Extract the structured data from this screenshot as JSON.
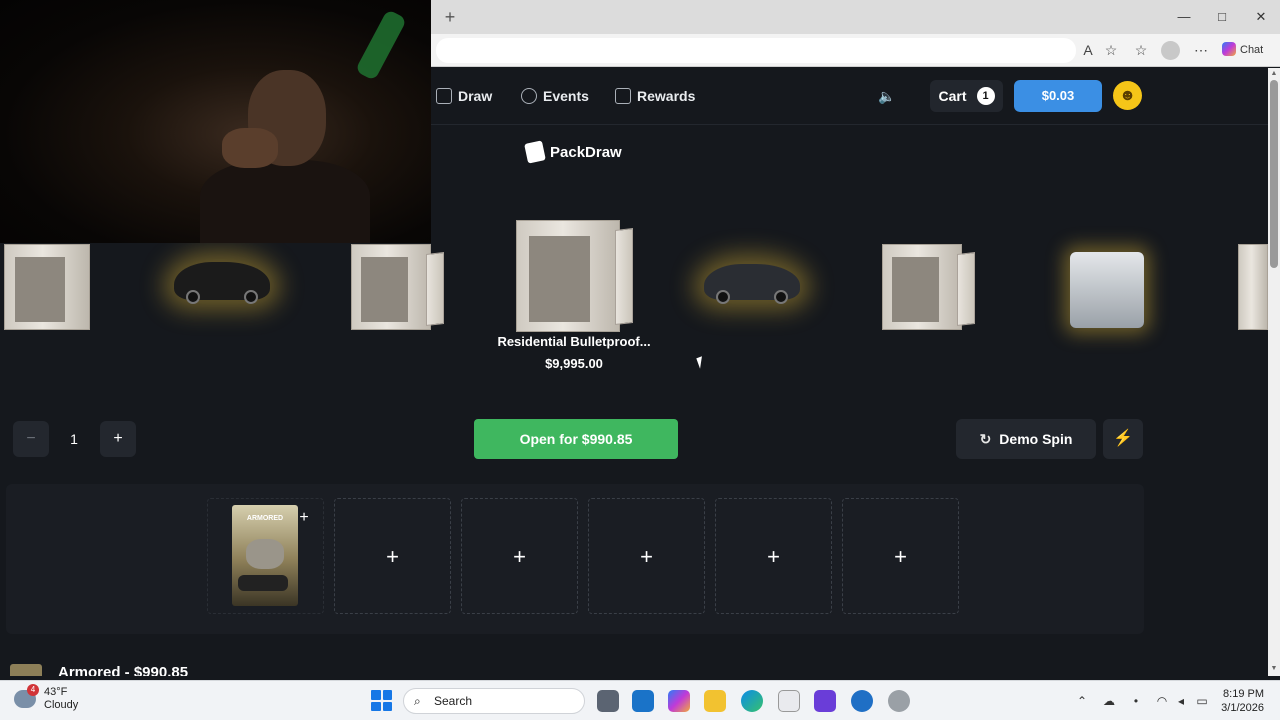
{
  "browser": {
    "new_tab_glyph": "+",
    "chat_label": "Chat",
    "window_controls": [
      "—",
      "□",
      "✕"
    ]
  },
  "nav": {
    "links": [
      {
        "label": "Draw",
        "icon": "draw-icon"
      },
      {
        "label": "Events",
        "icon": "events-icon"
      },
      {
        "label": "Rewards",
        "icon": "rewards-icon"
      }
    ],
    "cart_label": "Cart",
    "cart_count": "1",
    "balance": "$0.03",
    "accent_color": "#3b8fe4"
  },
  "brand": {
    "name": "PackDraw"
  },
  "spinner": {
    "featured_name": "Residential Bulletproof...",
    "featured_price": "$9,995.00",
    "items": [
      "vault",
      "car",
      "vault",
      "vault",
      "car",
      "vault",
      "generator",
      "vault"
    ]
  },
  "controls": {
    "quantity": "1",
    "minus": "−",
    "plus": "+",
    "open_label": "Open for $990.85",
    "open_color": "#3fb75f",
    "demo_label": "Demo Spin",
    "bolt": "⚡"
  },
  "packs": {
    "card_label": "ARMORED",
    "empty_slots": 5,
    "plus": "+"
  },
  "bottom": {
    "title": "Armored - $990.85"
  },
  "taskbar": {
    "temperature": "43°F",
    "condition": "Cloudy",
    "alert_count": "4",
    "search_placeholder": "Search",
    "time": "8:19 PM",
    "date": "3/1/2026"
  }
}
